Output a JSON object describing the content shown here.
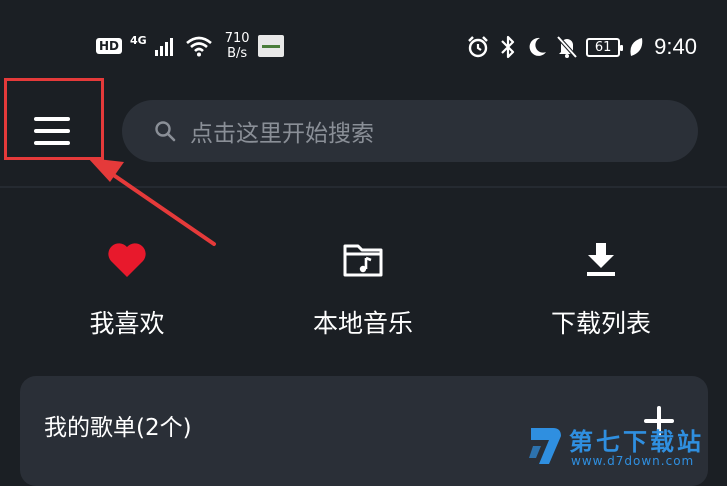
{
  "status_bar": {
    "hd": "HD",
    "network": "4G",
    "speed_value": "710",
    "speed_unit": "B/s",
    "battery": "61",
    "time": "9:40"
  },
  "header": {
    "search_placeholder": "点击这里开始搜索"
  },
  "quick_actions": [
    {
      "label": "我喜欢",
      "icon": "heart-icon"
    },
    {
      "label": "本地音乐",
      "icon": "music-folder-icon"
    },
    {
      "label": "下载列表",
      "icon": "download-icon"
    }
  ],
  "playlist_card": {
    "title": "我的歌单(2个)"
  },
  "watermark": {
    "name": "第七下载站",
    "url": "www.d7down.com"
  },
  "colors": {
    "background": "#1b1f24",
    "search_bg": "#2b3038",
    "card_bg": "#2a2f37",
    "highlight": "#e53a3a",
    "heart": "#e8192c",
    "watermark": "#2f8fe0"
  }
}
